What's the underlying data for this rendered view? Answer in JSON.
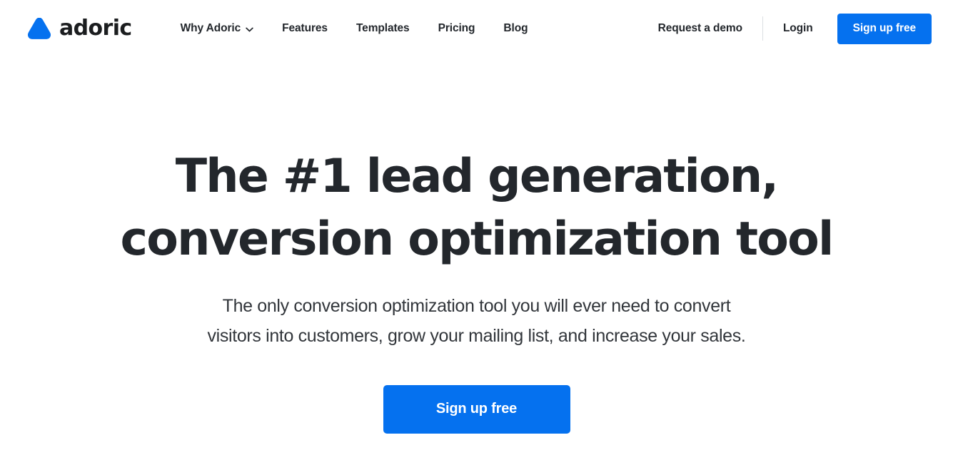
{
  "brand": {
    "name": "adoric",
    "logo_icon": "adoric-triangle-logo",
    "accent_color": "#0571EF",
    "text_color": "#1B1D1F"
  },
  "header": {
    "nav": [
      {
        "label": "Why Adoric",
        "has_dropdown": true,
        "icon": "chevron-down-icon"
      },
      {
        "label": "Features",
        "has_dropdown": false
      },
      {
        "label": "Templates",
        "has_dropdown": false
      },
      {
        "label": "Pricing",
        "has_dropdown": false
      },
      {
        "label": "Blog",
        "has_dropdown": false
      }
    ],
    "demo_label": "Request a demo",
    "login_label": "Login",
    "signup_label": "Sign up free"
  },
  "hero": {
    "title_line1": "The #1 lead generation,",
    "title_line2": "conversion optimization tool",
    "subtitle_line1": "The only conversion optimization tool you will ever need to convert",
    "subtitle_line2": "visitors into customers, grow your mailing list, and increase your sales.",
    "cta_label": "Sign up free",
    "title_color": "#23272C",
    "subtitle_color": "#32363B",
    "cta_bg": "#0571EF"
  }
}
